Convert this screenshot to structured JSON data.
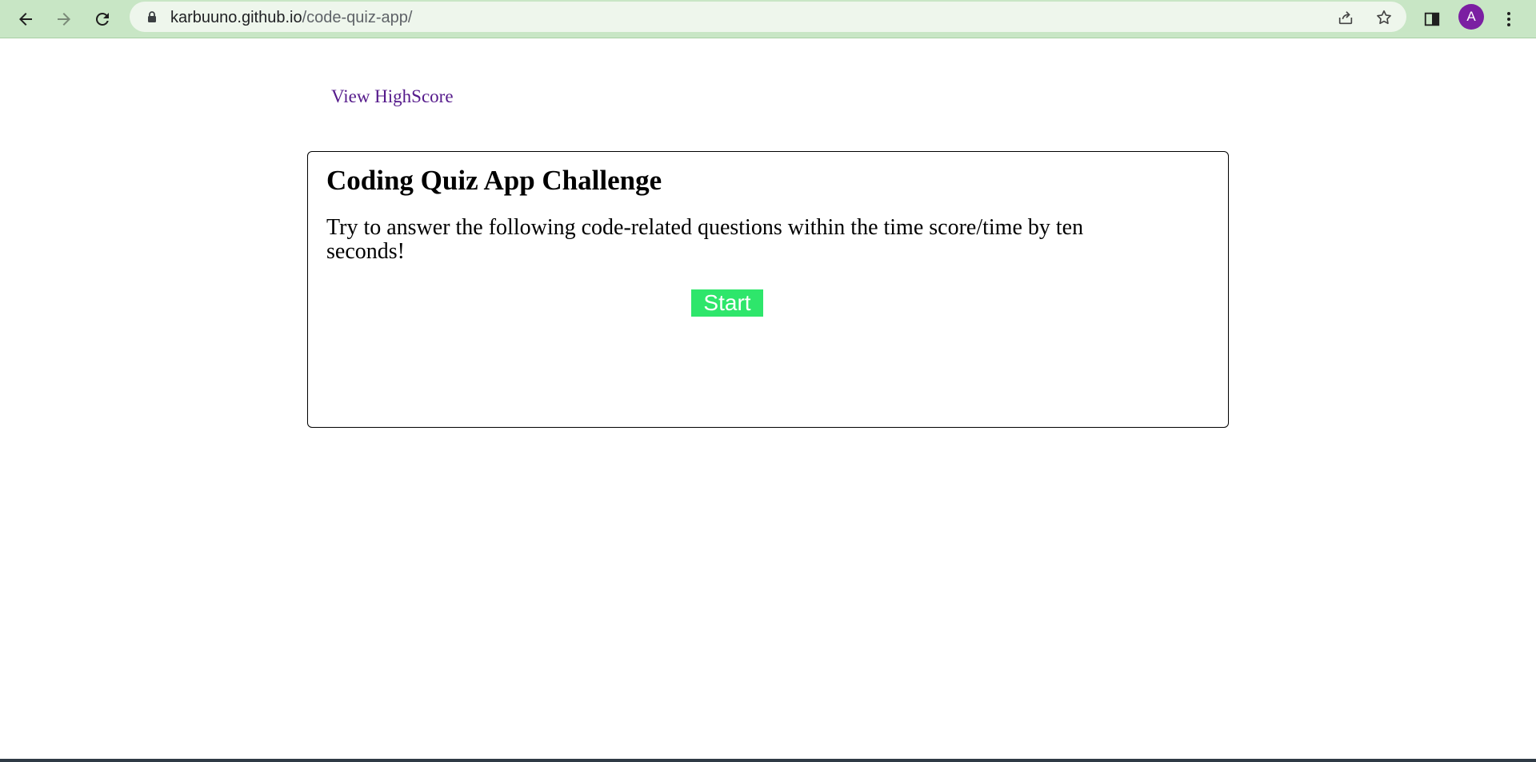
{
  "browser": {
    "url_domain": "karbuuno.github.io",
    "url_path": "/code-quiz-app/",
    "avatar_letter": "A",
    "icons": {
      "back": "arrow-left-icon",
      "forward": "arrow-right-icon",
      "reload": "reload-icon",
      "lock": "lock-icon",
      "share": "share-icon",
      "bookmark": "star-icon",
      "sidepanel": "side-panel-icon",
      "menu": "kebab-menu-icon"
    },
    "colors": {
      "toolbar": "#c8e6c5",
      "address_bar": "#eef6ec",
      "avatar": "#7b1fa2"
    }
  },
  "page": {
    "highscore_link": "View HighScore",
    "title": "Coding Quiz App Challenge",
    "description": "Try to answer the following code-related questions within the time score/time by ten seconds!",
    "start_button": "Start",
    "colors": {
      "link": "#551a8b",
      "start_button": "#2ee66b"
    }
  }
}
